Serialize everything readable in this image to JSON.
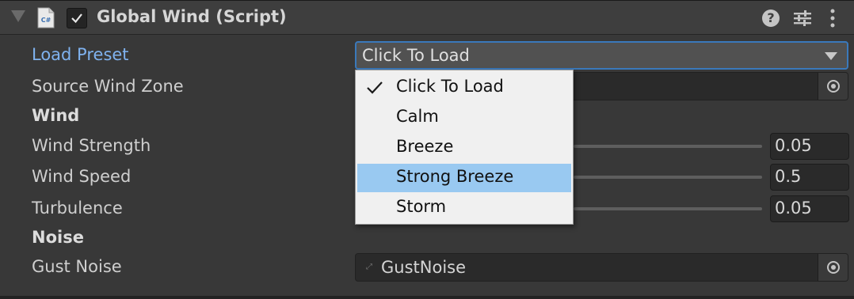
{
  "component": {
    "title": "Global Wind (Script)",
    "enabled": true,
    "icons": [
      "foldout-arrow-icon",
      "csharp-script-icon",
      "help-icon",
      "presets-icon",
      "context-menu-icon"
    ]
  },
  "fields": {
    "load_preset": {
      "label": "Load Preset",
      "value": "Click To Load"
    },
    "source_wind_zone": {
      "label": "Source Wind Zone",
      "value": ""
    },
    "wind_header": "Wind",
    "wind_strength": {
      "label": "Wind Strength",
      "value": "0.05"
    },
    "wind_speed": {
      "label": "Wind Speed",
      "value": "0.5"
    },
    "turbulence": {
      "label": "Turbulence",
      "value": "0.05"
    },
    "noise_header": "Noise",
    "gust_noise": {
      "label": "Gust Noise",
      "value": "GustNoise"
    }
  },
  "preset_menu": {
    "items": [
      "Click To Load",
      "Calm",
      "Breeze",
      "Strong Breeze",
      "Storm"
    ],
    "checked": "Click To Load",
    "highlighted": "Strong Breeze"
  },
  "colors": {
    "background": "#383838",
    "accent_label": "#7fb2ef",
    "focus_border": "#3a79bb",
    "menu_highlight": "#99c9f1"
  }
}
